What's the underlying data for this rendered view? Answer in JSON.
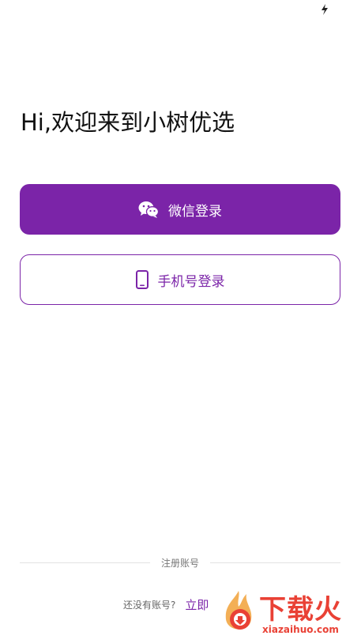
{
  "header": {
    "greeting": "Hi,欢迎来到小树优选"
  },
  "login": {
    "wechat_label": "微信登录",
    "phone_label": "手机号登录"
  },
  "register": {
    "divider_label": "注册账号",
    "prompt": "还没有账号?",
    "link_label": "立即"
  },
  "watermark": {
    "brand": "下载火",
    "url": "xiazaihuo.com"
  },
  "colors": {
    "accent": "#7b24a8",
    "watermark": "#e8372b"
  },
  "icons": {
    "status": "bolt-icon",
    "wechat": "wechat-icon",
    "phone": "phone-icon"
  }
}
